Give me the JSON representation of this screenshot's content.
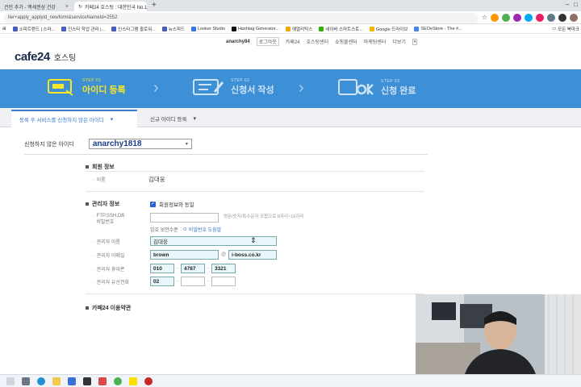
{
  "browser": {
    "tabs": [
      {
        "title": "건인 추가 - 맥세권상 건강",
        "active": false
      },
      {
        "title": "카페24 호스팅 : 대한민국 No.1",
        "active": true
      }
    ],
    "url": "ller+apply_applyid_newform&serviceNameId=2552",
    "bookmarks": [
      {
        "label": "소피트랜드 | 스마...",
        "color": "#4a5cc4"
      },
      {
        "label": "인스타 작업 관리 |...",
        "color": "#4a5cc4"
      },
      {
        "label": "인스타그램 팔로워...",
        "color": "#4a5cc4"
      },
      {
        "label": "뉴스피드",
        "color": "#4a5cc4"
      },
      {
        "label": "Looker Studio",
        "color": "#3b78e7"
      },
      {
        "label": "Hashtag Generator...",
        "color": "#111111"
      },
      {
        "label": "예열리틱스",
        "color": "#f2a900"
      },
      {
        "label": "네이버 스마트스토...",
        "color": "#2db400"
      },
      {
        "label": "Google 드라이브",
        "color": "#f4b400"
      },
      {
        "label": "SEOeStore - The #...",
        "color": "#4285f4"
      }
    ],
    "all_bookmarks": "모든 북마크"
  },
  "site": {
    "topnav": {
      "username": "anarchy84",
      "items": [
        "로그아웃",
        "카페24",
        "호스팅센터",
        "쇼핑몰센터",
        "마케팅센터",
        "더보기"
      ],
      "dropdown_icon": "▾"
    },
    "logo": {
      "brand": "cafe24",
      "sub": "호스팅"
    },
    "steps": [
      {
        "num": "STEP 01",
        "title": "아이디 등록",
        "state": "current",
        "icon": "keyboard-icon"
      },
      {
        "num": "STEP 02",
        "title": "신청서 작성",
        "state": "inactive",
        "icon": "form-icon"
      },
      {
        "num": "STEP 03",
        "title": "신청 완료",
        "state": "inactive",
        "icon": "ok-icon"
      }
    ],
    "page_tabs": [
      {
        "label": "등록 후 서비스를 신청하지 않은 아이디",
        "active": true
      },
      {
        "label": "신규 아이디 등록",
        "active": false
      }
    ],
    "id_select": {
      "label": "신청하지 않은 아이디",
      "value": "anarchy1818"
    },
    "member_section": {
      "title": "회원 정보",
      "name_label": "이름",
      "name_value": "김대웅"
    },
    "admin_section": {
      "title": "관리자 정보",
      "same_checkbox_label": "회원정보와 동일",
      "same_checked": true,
      "password_label_line1": "FTP,SSH,DB",
      "password_label_line2": "비밀번호",
      "password_hint": "영문/숫자/특수문자 조합으로 8자리~16자리",
      "security_label": "암호 보안수준",
      "security_help": "비밀번호 도움말",
      "admin_name_label": "관리자 이름",
      "admin_name_value": "김대웅",
      "email_label": "관리자 이메일",
      "email_local": "brown",
      "email_domain": "i-boss.co.kr",
      "mobile_label": "관리자 휴대폰",
      "mobile": [
        "010",
        "4787",
        "3321"
      ],
      "phone_label": "관리자 유선전화",
      "phone": [
        "02",
        "",
        ""
      ]
    },
    "terms_section": {
      "title": "카페24 이용약관"
    }
  },
  "colors": {
    "step_bar": "#3d8fd6",
    "step_current": "#f5e62a",
    "accent_blue": "#3a7bd5",
    "filled_field": "#e9f7fb"
  }
}
